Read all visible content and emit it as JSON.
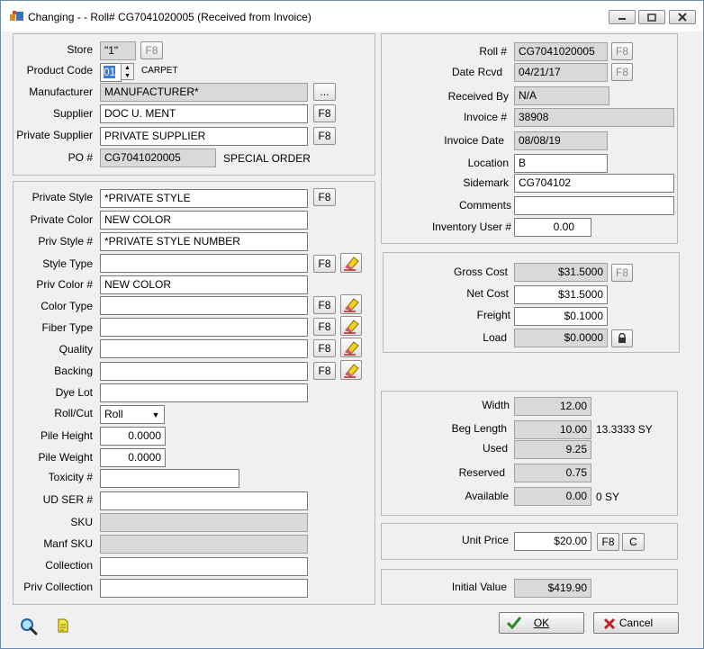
{
  "window": {
    "title": "Changing - - Roll# CG7041020005  (Received from Invoice)"
  },
  "left_top": {
    "store": {
      "label": "Store",
      "value": "\"1\"",
      "f8": "F8"
    },
    "product_code": {
      "label": "Product Code",
      "value": "01",
      "desc": "CARPET"
    },
    "manufacturer": {
      "label": "Manufacturer",
      "value": "MANUFACTURER*",
      "ellipsis": "..."
    },
    "supplier": {
      "label": "Supplier",
      "value": "DOC U. MENT",
      "f8": "F8"
    },
    "private_supplier": {
      "label": "Private Supplier",
      "value": "PRIVATE SUPPLIER",
      "f8": "F8"
    },
    "po": {
      "label": "PO #",
      "value": "CG7041020005",
      "note": "SPECIAL ORDER"
    }
  },
  "left_bottom": {
    "private_style": {
      "label": "Private Style",
      "value": "*PRIVATE STYLE",
      "f8": "F8"
    },
    "private_color": {
      "label": "Private Color",
      "value": "NEW COLOR"
    },
    "priv_style_no": {
      "label": "Priv Style #",
      "value": "*PRIVATE  STYLE NUMBER"
    },
    "style_type": {
      "label": "Style Type",
      "value": "",
      "f8": "F8"
    },
    "priv_color_no": {
      "label": "Priv Color #",
      "value": "NEW COLOR"
    },
    "color_type": {
      "label": "Color Type",
      "value": "",
      "f8": "F8"
    },
    "fiber_type": {
      "label": "Fiber Type",
      "value": "",
      "f8": "F8"
    },
    "quality": {
      "label": "Quality",
      "value": "",
      "f8": "F8"
    },
    "backing": {
      "label": "Backing",
      "value": "",
      "f8": "F8"
    },
    "dye_lot": {
      "label": "Dye Lot",
      "value": ""
    },
    "roll_cut": {
      "label": "Roll/Cut",
      "value": "Roll"
    },
    "pile_height": {
      "label": "Pile Height",
      "value": "0.0000"
    },
    "pile_weight": {
      "label": "Pile Weight",
      "value": "0.0000"
    },
    "toxicity": {
      "label": "Toxicity #",
      "value": ""
    },
    "ud_ser": {
      "label": "UD SER #",
      "value": ""
    },
    "sku": {
      "label": "SKU",
      "value": ""
    },
    "manf_sku": {
      "label": "Manf SKU",
      "value": ""
    },
    "collection": {
      "label": "Collection",
      "value": ""
    },
    "priv_collection": {
      "label": "Priv Collection",
      "value": ""
    }
  },
  "right_top": {
    "roll": {
      "label": "Roll #",
      "value": "CG7041020005",
      "f8": "F8"
    },
    "date_rcvd": {
      "label": "Date Rcvd",
      "value": "04/21/17",
      "f8": "F8"
    },
    "received_by": {
      "label": "Received By",
      "value": "N/A"
    },
    "invoice": {
      "label": "Invoice #",
      "value": "38908"
    },
    "invoice_date": {
      "label": "Invoice Date",
      "value": "08/08/19"
    },
    "location": {
      "label": "Location",
      "value": "B"
    },
    "sidemark": {
      "label": "Sidemark",
      "value": "CG704102"
    },
    "comments": {
      "label": "Comments",
      "value": ""
    },
    "inventory_user": {
      "label": "Inventory User #",
      "value": "0.00"
    }
  },
  "cost": {
    "gross_cost": {
      "label": "Gross Cost",
      "value": "$31.5000",
      "f8": "F8"
    },
    "net_cost": {
      "label": "Net Cost",
      "value": "$31.5000"
    },
    "freight": {
      "label": "Freight",
      "value": "$0.1000"
    },
    "load": {
      "label": "Load",
      "value": "$0.0000"
    }
  },
  "dimensions": {
    "width": {
      "label": "Width",
      "value": "12.00"
    },
    "beg_length": {
      "label": "Beg Length",
      "value": "10.00",
      "sy": "13.3333 SY"
    },
    "used": {
      "label": "Used",
      "value": "9.25"
    },
    "reserved": {
      "label": "Reserved",
      "value": "0.75"
    },
    "available": {
      "label": "Available",
      "value": "0.00",
      "sy": "0 SY"
    }
  },
  "price": {
    "unit_price": {
      "label": "Unit Price",
      "value": "$20.00",
      "f8": "F8",
      "c": "C"
    },
    "initial_value": {
      "label": "Initial Value",
      "value": "$419.90"
    }
  },
  "footer": {
    "ok": "OK",
    "cancel": "Cancel"
  },
  "colors": {
    "accent": "#3b7de0",
    "readonly": "#d9d9d9",
    "ok_check": "#2a8a2a",
    "cancel_x": "#c02020"
  }
}
